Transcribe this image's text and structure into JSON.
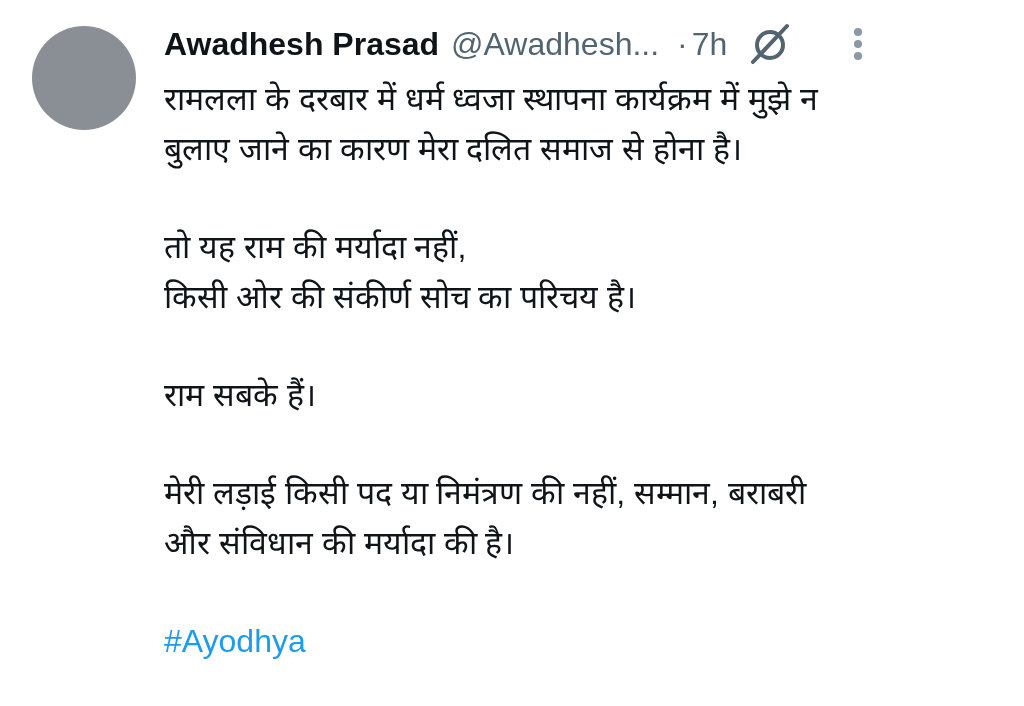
{
  "post": {
    "author_name": "Awadhesh Prasad",
    "handle": "@Awadhesh...",
    "separator": "·",
    "time": "7h",
    "paragraphs": [
      [
        "रामलला के दरबार में धर्म ध्वजा स्थापना कार्यक्रम में मुझे न",
        "बुलाए जाने का कारण मेरा दलित समाज से होना है।"
      ],
      [
        "तो यह राम की मर्यादा नहीं,",
        "किसी ओर की संकीर्ण सोच का परिचय है।"
      ],
      [
        "राम सबके हैं।"
      ],
      [
        "मेरी लड़ाई किसी पद या निमंत्रण की नहीं, सम्मान, बराबरी",
        "और संविधान की मर्यादा की है।"
      ]
    ],
    "hashtag": "#Ayodhya"
  }
}
